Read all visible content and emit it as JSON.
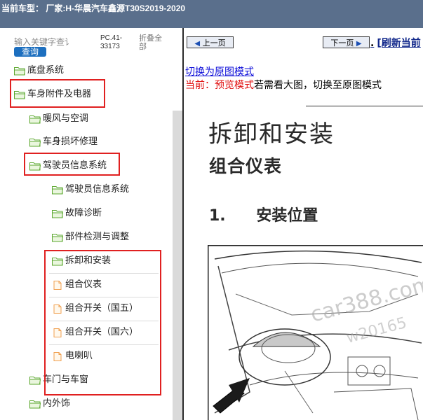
{
  "titlebar": {
    "title": "当前车型： 厂家:H-华晨汽车鑫源T30S2019-2020"
  },
  "sidebar": {
    "search_placeholder": "输入关键字查讠",
    "search_button": "查询",
    "pc_code": "PC.41-33173",
    "collapse_all": "折叠全部",
    "items": [
      {
        "label": "底盘系统",
        "icon": "folder-open-icon"
      },
      {
        "label": "车身附件及电器",
        "icon": "folder-open-icon"
      },
      {
        "label": "暖风与空调",
        "icon": "folder-open-icon"
      },
      {
        "label": "车身损坏修理",
        "icon": "folder-open-icon"
      },
      {
        "label": "驾驶员信息系统",
        "icon": "folder-open-icon"
      },
      {
        "label": "驾驶员信息系统",
        "icon": "folder-open-icon"
      },
      {
        "label": "故障诊断",
        "icon": "folder-open-icon"
      },
      {
        "label": "部件检测与调整",
        "icon": "folder-open-icon"
      },
      {
        "label": "拆卸和安装",
        "icon": "folder-open-icon"
      },
      {
        "label": "组合仪表",
        "icon": "document-icon"
      },
      {
        "label": "组合开关（国五）",
        "icon": "document-icon"
      },
      {
        "label": "组合开关（国六）",
        "icon": "document-icon"
      },
      {
        "label": "电喇叭",
        "icon": "document-icon"
      },
      {
        "label": "车门与车窗",
        "icon": "folder-open-icon"
      },
      {
        "label": "内外饰",
        "icon": "folder-open-icon"
      }
    ]
  },
  "content": {
    "prev_label": "上一页",
    "next_label": "下一页",
    "refresh_label": "[刷新当前",
    "switch_link": "切换为原图模式",
    "current_prefix": "当前：预览模式",
    "current_suffix": "若需看大图，切换至原图模式",
    "doc_title": "拆卸和安装",
    "doc_subtitle": "组合仪表",
    "section_number": "1.",
    "section_title": "安装位置",
    "watermark_text": "car388.com",
    "watermark_code": "w20165"
  },
  "colors": {
    "titlebar_bg": "#5a6f8c",
    "highlight": "#e02020",
    "folder": "#5aa72c",
    "document": "#f0a050",
    "link": "#0b0bd8"
  }
}
